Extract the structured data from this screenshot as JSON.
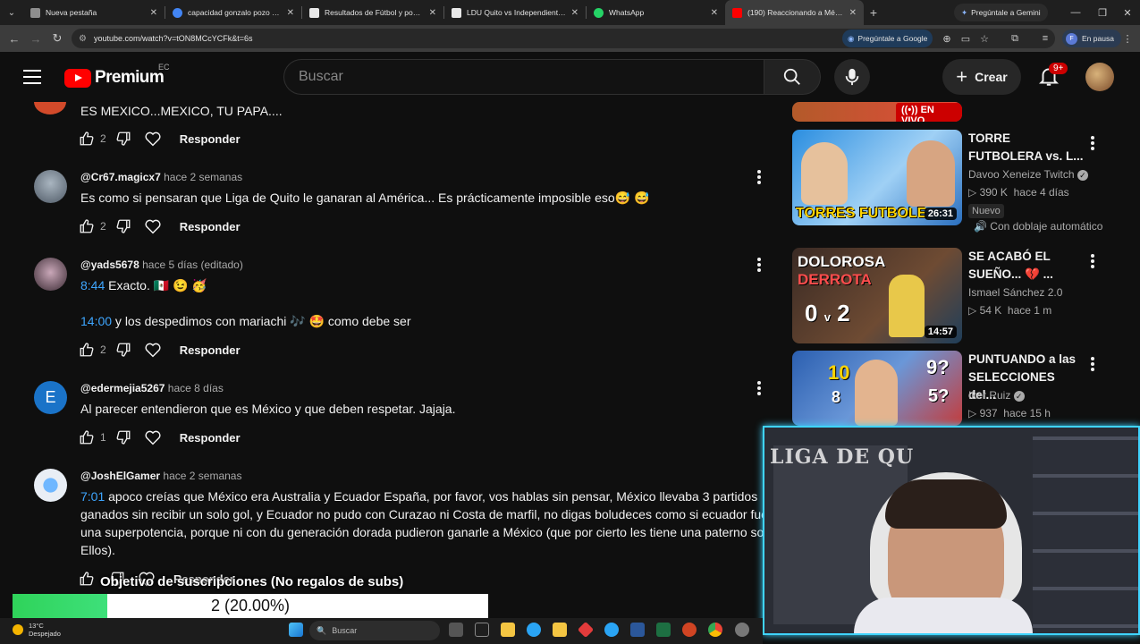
{
  "browser": {
    "tabs": [
      {
        "title": "Nueva pestaña",
        "color": "#8e8e8e"
      },
      {
        "title": "capacidad gonzalo pozo ripalda",
        "color": "#4285f4"
      },
      {
        "title": "Resultados de Fútbol y posición",
        "color": "#e8e8e8"
      },
      {
        "title": "LDU Quito vs Independiente Va",
        "color": "#e8e8e8"
      },
      {
        "title": "WhatsApp",
        "color": "#25d366"
      },
      {
        "title": "(190) Reaccionando a México 2",
        "color": "#ff0000",
        "active": true
      }
    ],
    "gemini_label": "Pregúntale a Gemini",
    "url": "youtube.com/watch?v=tON8MCcYCFk&t=6s",
    "ask_google_label": "Pregúntale a Google",
    "profile_initial": "F",
    "paused_label": "En pausa"
  },
  "youtube": {
    "logo_text": "Premium",
    "country_code": "EC",
    "search_placeholder": "Buscar",
    "create_label": "Crear",
    "notifications_badge": "9+"
  },
  "comments": [
    {
      "text": "ES MEXICO...MEXICO, TU PAPA....",
      "likes": "2",
      "reply_label": "Responder",
      "avatar_color": "#d24a2a"
    },
    {
      "author": "@Cr67.magicx7",
      "when": "hace 2 semanas",
      "text": "Es como si pensaran que Liga de Quito le ganaran al América... Es prácticamente imposible eso😅 😅",
      "likes": "2",
      "reply_label": "Responder",
      "avatar_color": "#7b8c99"
    },
    {
      "author": "@yads5678",
      "when": "hace 5 días (editado)",
      "ts1": "8:44",
      "text1": " Exacto. 🇲🇽 😉 🥳",
      "ts2": "14:00",
      "text2": " y los despedimos con mariachi 🎶 🤩 como debe ser",
      "likes": "2",
      "reply_label": "Responder",
      "avatar_color": "#8a6a7a"
    },
    {
      "author": "@edermejia5267",
      "when": "hace 8 días",
      "avatar_letter": "E",
      "text": "Al parecer entendieron que es México y que deben respetar. Jajaja.",
      "likes": "1",
      "reply_label": "Responder",
      "avatar_color": "#1a73c8"
    },
    {
      "author": "@JoshElGamer",
      "when": "hace 2 semanas",
      "ts": "7:01",
      "line1": " apoco creías que México era Australia y Ecuador España, por favor, vos hablas sin pensar, México llevaba 3 partidos",
      "line2": "ganados sin recibir un solo gol, y Ecuador no pudo con Curazao ni Costa de marfil, no digas boludeces como si ecuador fue",
      "line3": "una superpotencia, porque ni con du generación dorada pudieron ganarle a México (que por cierto les tiene una paterno sol",
      "line4": "Ellos).",
      "reply_label": "Responder",
      "avatar_color": "#e9eef5"
    }
  ],
  "sidebar": {
    "videos": [
      {
        "live_label": "EN VIVO"
      },
      {
        "title_line1": "TORRE",
        "title_line2": "FUTBOLERA vs. L...",
        "channel": "Davoo Xeneize Twitch",
        "views": "390 K",
        "age": "hace 4 días",
        "new_badge": "Nuevo",
        "dub_label": "Con doblaje automático",
        "duration": "26:31",
        "thumb_caption": "TORRES FUTBOLE",
        "thumb_color": "#2a7fd6"
      },
      {
        "title_line1": "SE ACABÓ EL",
        "title_line2": "SUEÑO... 💔 ...",
        "channel": "Ismael Sánchez 2.0",
        "views": "54 K",
        "age": "hace 1 m",
        "duration": "14:57",
        "thumb_caption_1": "DOLOROSA",
        "thumb_caption_2": "DERROTA",
        "thumb_score_left": "0",
        "thumb_score_vs": "v",
        "thumb_score_right": "2",
        "thumb_color": "#3a2a24"
      },
      {
        "title_line1": "PUNTUANDO a las",
        "title_line2": "SELECCIONES del...",
        "channel": "Iker Ruiz",
        "views": "937",
        "age": "hace 15 h",
        "thumb_n1": "10",
        "thumb_n2": "9?",
        "thumb_n3": "8",
        "thumb_n4": "5?",
        "thumb_color": "#2b5fb0"
      }
    ]
  },
  "overlay": {
    "goal_title": "Objetivo de suscripciones (No regalos de subs)",
    "goal_progress": 0.2,
    "goal_text": "2 (20.00%)",
    "webcam_banner": "LIGA DE QU"
  },
  "taskbar": {
    "temp": "13°C",
    "weather": "Despejado",
    "search_placeholder": "Buscar"
  }
}
